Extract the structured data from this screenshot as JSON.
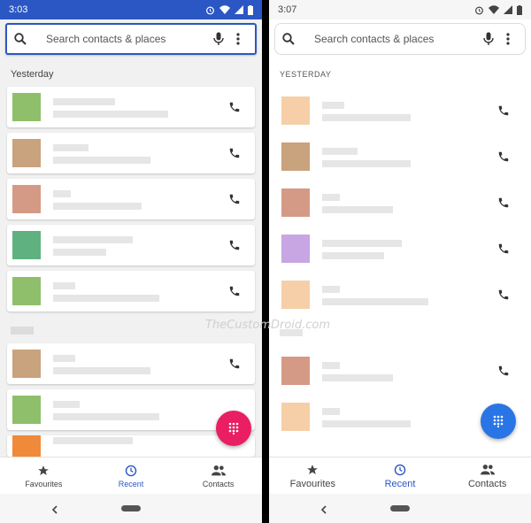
{
  "left_phone": {
    "status": {
      "time": "3:03"
    },
    "search": {
      "placeholder": "Search contacts & places"
    },
    "section_label": "Yesterday",
    "nav": {
      "favourites": "Favourites",
      "recent": "Recent",
      "contacts": "Contacts"
    },
    "colors": {
      "accent": "#2a57c4",
      "fab": "#e91e63"
    }
  },
  "right_phone": {
    "status": {
      "time": "3:07"
    },
    "search": {
      "placeholder": "Search contacts & places"
    },
    "section_label": "YESTERDAY",
    "nav": {
      "favourites": "Favourites",
      "recent": "Recent",
      "contacts": "Contacts"
    },
    "colors": {
      "accent": "#2a57c4",
      "fab": "#2a75e6"
    }
  },
  "watermark": "TheCustomDroid.com"
}
